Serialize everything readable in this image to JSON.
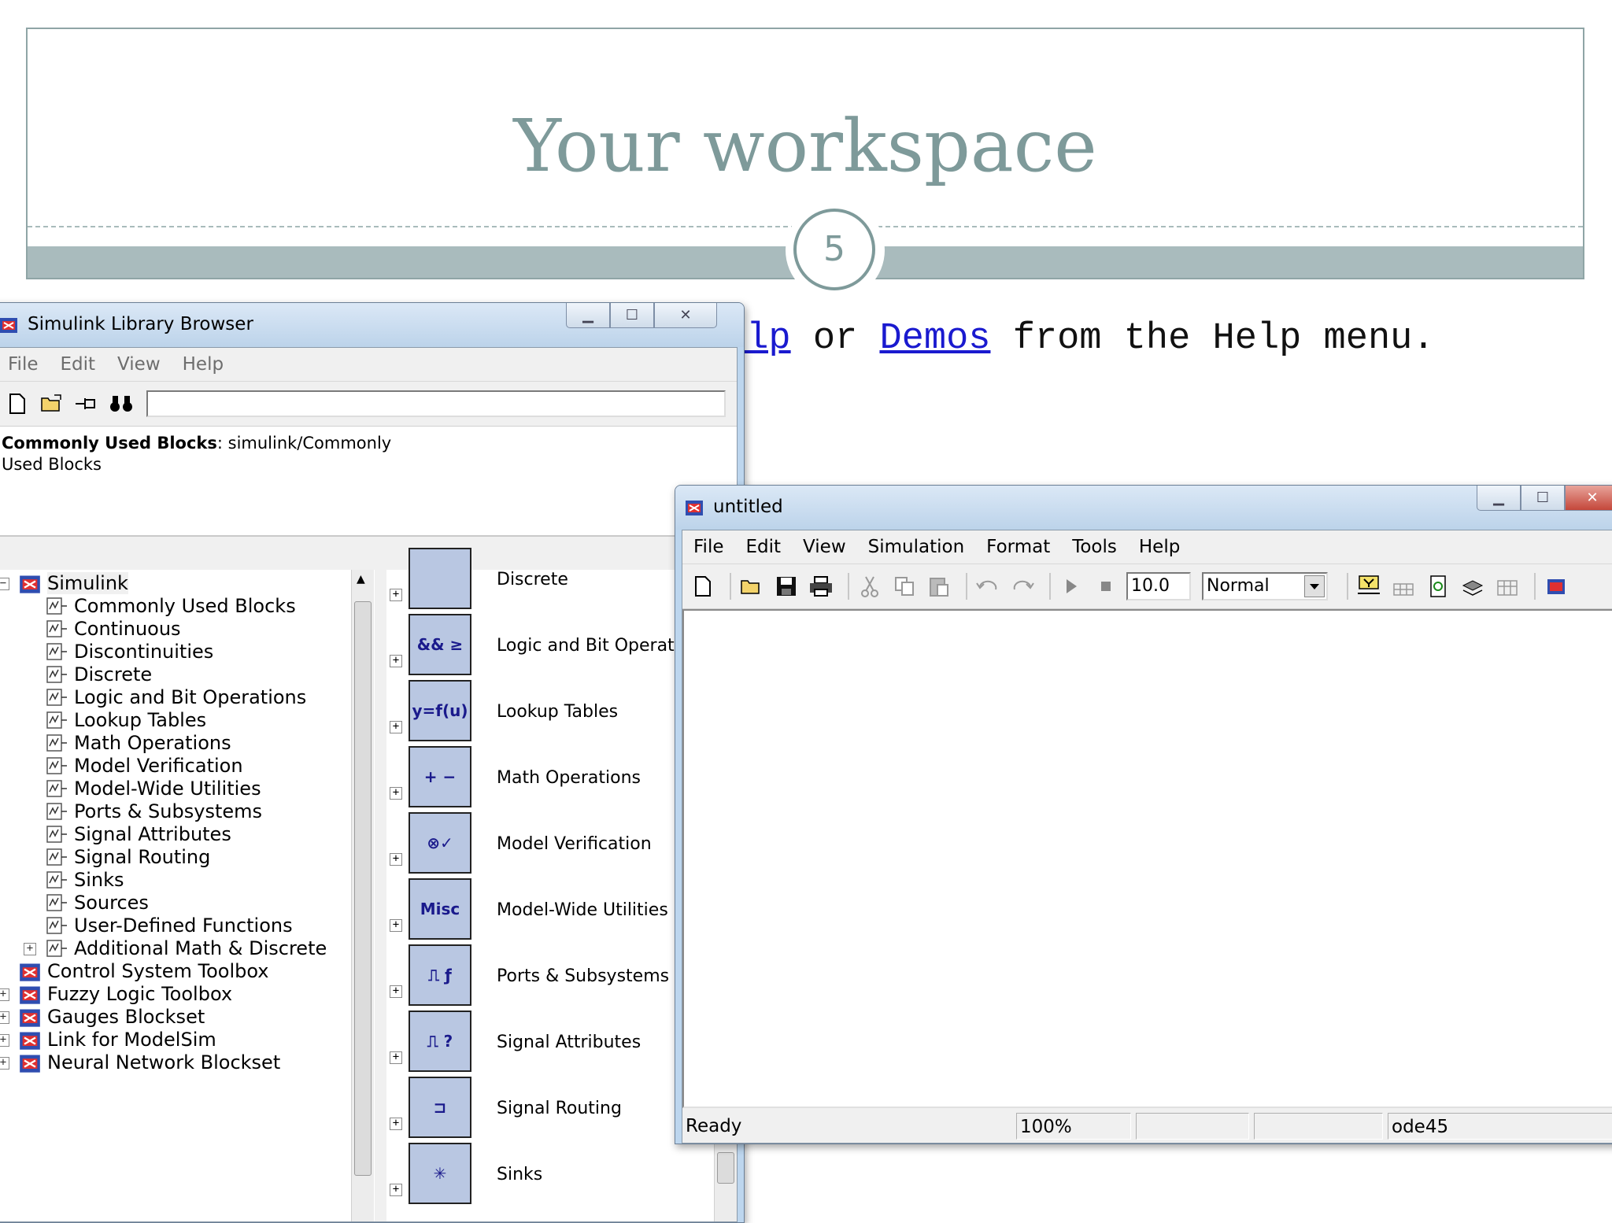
{
  "slide": {
    "title": "Your workspace",
    "number": "5"
  },
  "background_text": {
    "prefix": "elp",
    "middle": " or ",
    "link": "Demos",
    "suffix": " from the Help menu."
  },
  "library_browser": {
    "title": "Simulink Library Browser",
    "menu": [
      "File",
      "Edit",
      "View",
      "Help"
    ],
    "search_value": "",
    "description_bold": "Commonly Used Blocks",
    "description_text": ": simulink/Commonly",
    "description_text2": "Used Blocks",
    "tree": {
      "root": "Simulink",
      "children": [
        "Commonly Used Blocks",
        "Continuous",
        "Discontinuities",
        "Discrete",
        "Logic and Bit Operations",
        "Lookup Tables",
        "Math Operations",
        "Model Verification",
        "Model-Wide Utilities",
        "Ports & Subsystems",
        "Signal Attributes",
        "Signal Routing",
        "Sinks",
        "Sources",
        "User-Defined Functions",
        "Additional Math & Discrete"
      ],
      "toolboxes": [
        "Control System Toolbox",
        "Fuzzy Logic Toolbox",
        "Gauges Blockset",
        "Link for ModelSim",
        "Neural Network Blockset"
      ]
    },
    "blocks": [
      {
        "label": "Discrete",
        "icon": "discrete-icon",
        "glyph": ""
      },
      {
        "label": "Logic and Bit Operatio",
        "icon": "logic-icon",
        "glyph": "&& ≥"
      },
      {
        "label": "Lookup Tables",
        "icon": "lookup-icon",
        "glyph": "y=f(u)"
      },
      {
        "label": "Math Operations",
        "icon": "math-icon",
        "glyph": "+ −"
      },
      {
        "label": "Model Verification",
        "icon": "verification-icon",
        "glyph": "⊗✓"
      },
      {
        "label": "Model-Wide Utilities",
        "icon": "misc-icon",
        "glyph": "Misc"
      },
      {
        "label": "Ports & Subsystems",
        "icon": "ports-icon",
        "glyph": "⎍ ƒ"
      },
      {
        "label": "Signal Attributes",
        "icon": "attributes-icon",
        "glyph": "⎍ ?"
      },
      {
        "label": "Signal Routing",
        "icon": "routing-icon",
        "glyph": "⊐"
      },
      {
        "label": "Sinks",
        "icon": "sinks-icon",
        "glyph": "✳"
      }
    ]
  },
  "model_window": {
    "title": "untitled",
    "menu": [
      "File",
      "Edit",
      "View",
      "Simulation",
      "Format",
      "Tools",
      "Help"
    ],
    "stop_time": "10.0",
    "sim_mode": "Normal",
    "status": {
      "state": "Ready",
      "zoom": "100%",
      "solver": "ode45"
    }
  },
  "colors": {
    "accent": "#7e9a9a",
    "block_fill": "#b9c7e2",
    "titlebar": "#bcd3ea"
  }
}
